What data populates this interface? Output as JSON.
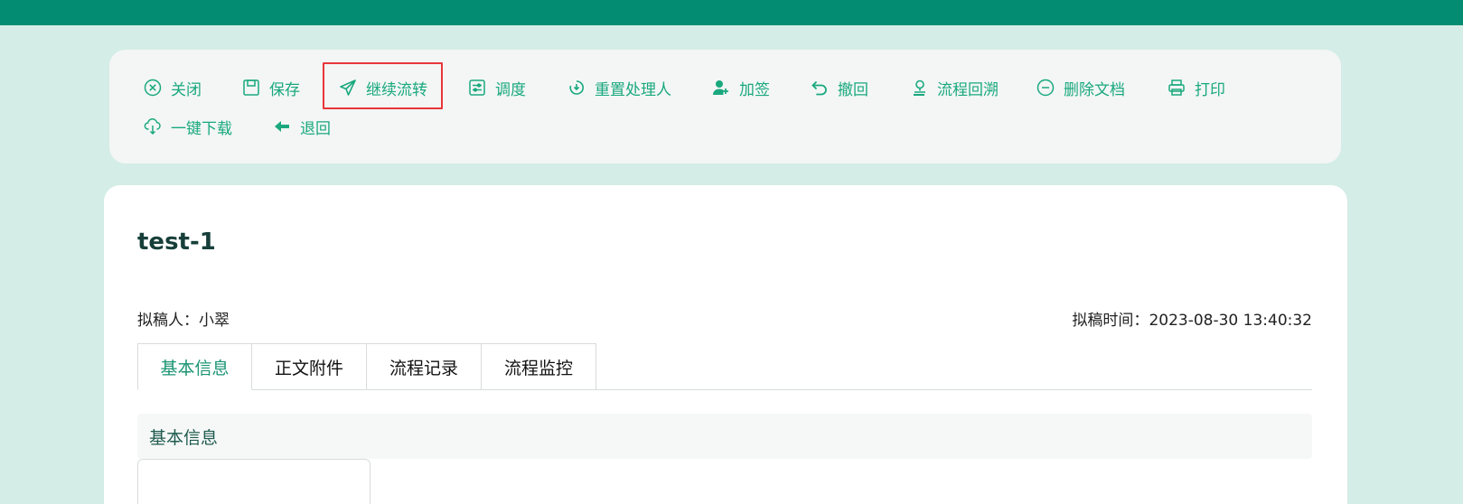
{
  "colors": {
    "top_bar": "#038c72",
    "page_background": "#d4ede6",
    "accent": "#1aa87e",
    "highlight": "#e8363a"
  },
  "toolbar": {
    "buttons": [
      {
        "icon": "close-circle-icon",
        "label": "关闭"
      },
      {
        "icon": "save-icon",
        "label": "保存"
      },
      {
        "icon": "send-plane-icon",
        "label": "继续流转"
      },
      {
        "icon": "adjust-icon",
        "label": "调度"
      },
      {
        "icon": "reset-handler-icon",
        "label": "重置处理人"
      },
      {
        "icon": "add-user-icon",
        "label": "加签"
      },
      {
        "icon": "undo-icon",
        "label": "撤回"
      },
      {
        "icon": "stamp-icon",
        "label": "流程回溯"
      },
      {
        "icon": "minus-circle-icon",
        "label": "删除文档"
      },
      {
        "icon": "printer-icon",
        "label": "打印"
      },
      {
        "icon": "cloud-download-icon",
        "label": "一键下载"
      },
      {
        "icon": "arrow-left-icon",
        "label": "退回"
      }
    ]
  },
  "document": {
    "title": "test-1",
    "drafter_label": "拟稿人：",
    "drafter_name": "小翠",
    "draft_time_label": "拟稿时间：",
    "draft_time": "2023-08-30 13:40:32"
  },
  "tabs": [
    {
      "label": "基本信息",
      "active": true
    },
    {
      "label": "正文附件",
      "active": false
    },
    {
      "label": "流程记录",
      "active": false
    },
    {
      "label": "流程监控",
      "active": false
    }
  ],
  "section": {
    "title": "基本信息"
  }
}
